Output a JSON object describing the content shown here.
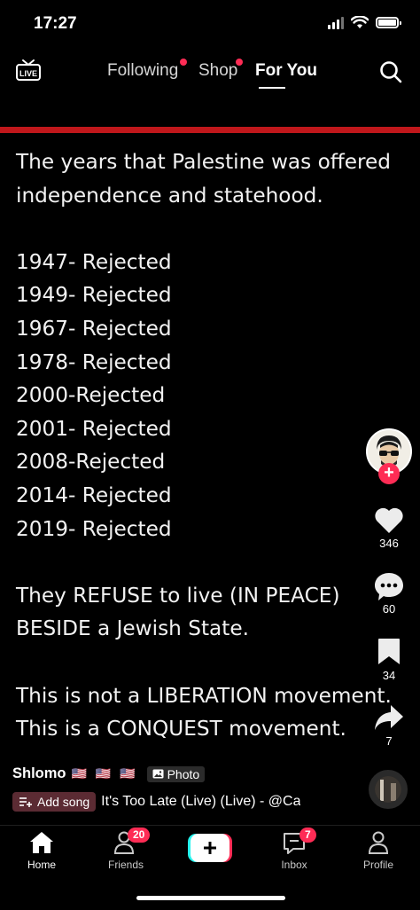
{
  "status_bar": {
    "time": "17:27"
  },
  "top_nav": {
    "tabs": [
      {
        "label": "Following",
        "has_dot": true
      },
      {
        "label": "Shop",
        "has_dot": true
      },
      {
        "label": "For You",
        "active": true
      }
    ],
    "live_icon": "live-tv-icon",
    "search_icon": "search-icon"
  },
  "post": {
    "photo_text": "The years that Palestine was offered\nindependence and statehood.\n\n1947- Rejected\n1949- Rejected\n1967- Rejected\n1978- Rejected\n2000-Rejected\n2001- Rejected\n2008-Rejected\n2014- Rejected\n2019- Rejected\n\nThey REFUSE to live (IN PEACE)\nBESIDE a Jewish State.\n\nThis is not a LIBERATION movement.\nThis is a CONQUEST movement.",
    "author": "Shlomo",
    "flags": "🇺🇸 🇺🇸 🇺🇸",
    "media_type": "Photo",
    "add_song": "Add song",
    "song": "It's Too Late (Live) (Live) - @Ca"
  },
  "actions": {
    "likes": "346",
    "comments": "60",
    "saves": "34",
    "shares": "7"
  },
  "bottom_nav": {
    "home": "Home",
    "friends": "Friends",
    "friends_badge": "20",
    "inbox": "Inbox",
    "inbox_badge": "7",
    "profile": "Profile"
  },
  "colors": {
    "accent": "#fe2c55",
    "banner_red": "#c0171b",
    "background": "#000000"
  }
}
